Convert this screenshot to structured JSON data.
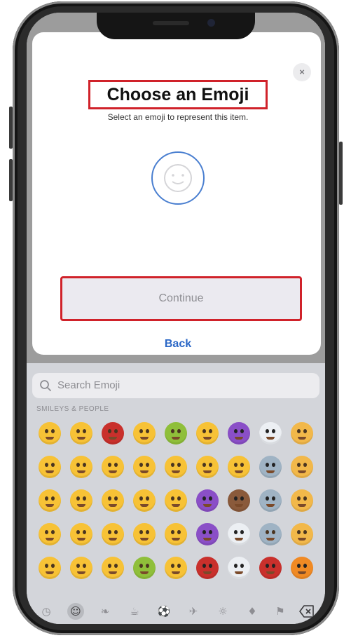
{
  "dialog": {
    "title": "Choose an Emoji",
    "subtitle": "Select an emoji to represent this item.",
    "close_icon": "×",
    "placeholder_icon": "smiley-face-outline-icon",
    "continue_label": "Continue",
    "back_label": "Back",
    "highlight_color": "#d0222a",
    "accent_color": "#2b67c6"
  },
  "keyboard": {
    "search": {
      "placeholder": "Search Emoji"
    },
    "section_label": "SMILEYS & PEOPLE",
    "emoji_rows": [
      [
        "neutral-face",
        "hushed-face",
        "tired-face",
        "astonished-face",
        "nauseated-face",
        "money-mouth-face",
        "red-devil-mask",
        "skull-and-crossbones",
        "smiling-cat"
      ],
      [
        "confused-face",
        "flushed-face",
        "sleepy-face",
        "nerd-face",
        "sneezing-face",
        "cowboy-face",
        "clown-face",
        "alien",
        "grinning-cat"
      ],
      [
        "expressionless-face",
        "grimacing-face",
        "sad-face",
        "mask-face",
        "bandage-face",
        "smiling-imp",
        "pile-of-poo",
        "alien-monster",
        "crying-cat"
      ],
      [
        "grinning-sweat-face",
        "frowning-face",
        "pensive-face",
        "zany-face",
        "lying-face",
        "angry-imp",
        "ghost",
        "robot-face",
        "heart-eyes-cat"
      ],
      [
        "tears-of-joy-face",
        "open-mouth-face",
        "thinking-face",
        "vomiting-face",
        "monocle-face",
        "ogre",
        "skull",
        "goblin",
        "jack-o-lantern"
      ]
    ],
    "categories": [
      "clock-recent-icon",
      "smiley-icon",
      "cat-icon",
      "food-icon",
      "ball-icon",
      "car-icon",
      "lightbulb-icon",
      "symbols-icon",
      "flag-icon"
    ],
    "active_category": "smiley-icon",
    "delete_icon": "backspace-icon"
  }
}
